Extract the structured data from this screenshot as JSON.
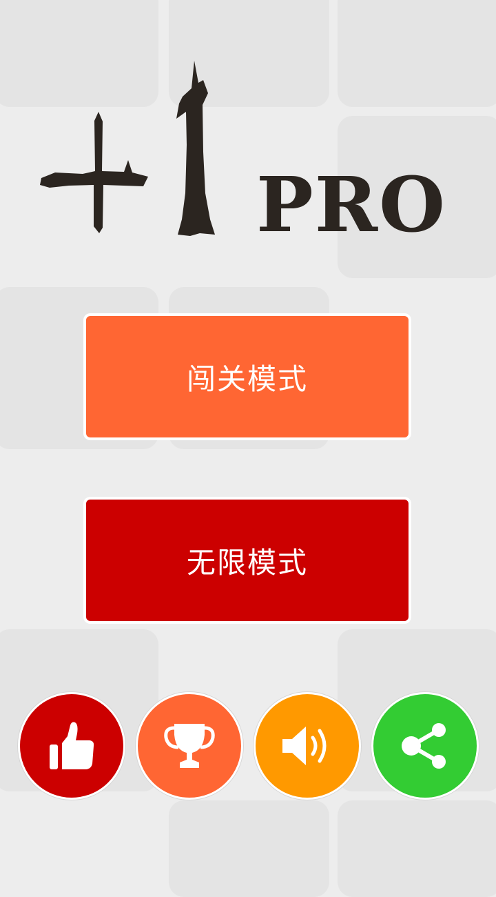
{
  "logo": {
    "numeral": "+1",
    "suffix": "PRO"
  },
  "menu": {
    "level_mode_label": "闯关模式",
    "endless_mode_label": "无限模式"
  },
  "toolbar": {
    "like_icon": "thumbs-up-icon",
    "rank_icon": "trophy-icon",
    "sound_icon": "speaker-icon",
    "share_icon": "share-icon"
  },
  "colors": {
    "level_button": "#ff6633",
    "endless_button": "#cc0000",
    "like_button": "#cc0000",
    "rank_button": "#ff6633",
    "sound_button": "#ff9900",
    "share_button": "#33cc33",
    "background": "#ededed",
    "logo_ink": "#2b2520"
  }
}
